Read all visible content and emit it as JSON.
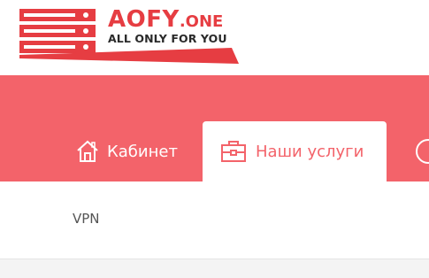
{
  "brand": {
    "name": "AOFY",
    "suffix": ".ONE",
    "tagline": "ALL ONLY FOR YOU"
  },
  "nav": {
    "tabs": [
      {
        "label": "Кабинет",
        "icon": "home-icon"
      },
      {
        "label": "Наши услуги",
        "icon": "briefcase-icon",
        "active": true
      },
      {
        "label": "",
        "icon": "help-icon"
      }
    ]
  },
  "submenu": {
    "items": [
      {
        "label": "VPN"
      }
    ]
  },
  "colors": {
    "accent": "#f3636a",
    "brand_red": "#e63d42",
    "text_dark": "#2a2a2a"
  }
}
